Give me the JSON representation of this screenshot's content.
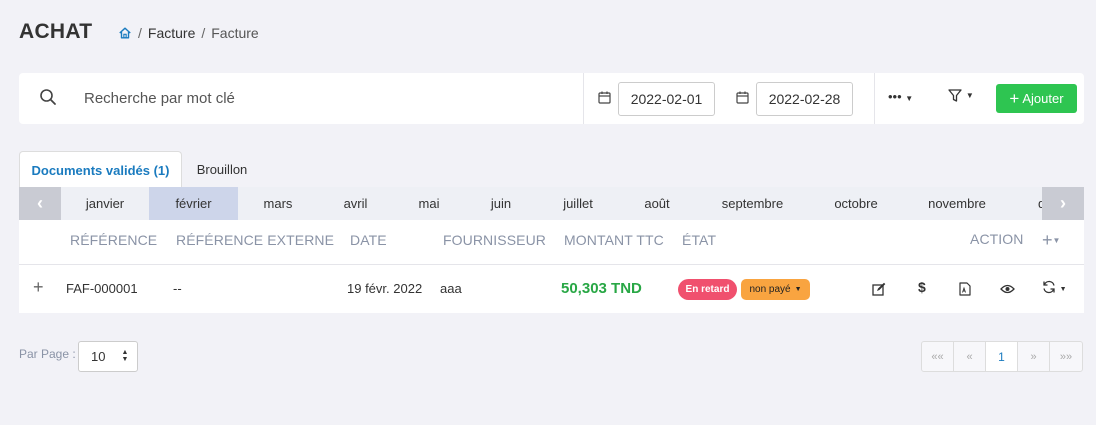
{
  "header": {
    "title": "ACHAT",
    "breadcrumb": [
      "Facture",
      "Facture"
    ],
    "separator": "/"
  },
  "search": {
    "placeholder": "Recherche par mot clé",
    "date_from": "2022-02-01",
    "date_to": "2022-02-28",
    "more_label": "•••",
    "add_label": "Ajouter"
  },
  "tabs": [
    {
      "label": "Documents validés (1)",
      "active": true
    },
    {
      "label": "Brouillon",
      "active": false
    }
  ],
  "months": {
    "items": [
      "janvier",
      "février",
      "mars",
      "avril",
      "mai",
      "juin",
      "juillet",
      "août",
      "septembre",
      "octobre",
      "novembre",
      "d"
    ],
    "selected": "février"
  },
  "table": {
    "columns": {
      "reference": "RÉFÉRENCE",
      "external_reference": "RÉFÉRENCE EXTERNE",
      "date": "DATE",
      "supplier": "FOURNISSEUR",
      "amount": "MONTANT TTC",
      "state": "ÉTAT",
      "action": "ACTION"
    },
    "rows": [
      {
        "reference": "FAF-000001",
        "external_reference": "--",
        "date": "19 févr. 2022",
        "supplier": "aaa",
        "amount": "50,303 TND",
        "status_late": "En retard",
        "status_payment": "non payé"
      }
    ]
  },
  "footer": {
    "per_page_label": "Par Page :",
    "per_page_value": "10",
    "pagination": [
      "««",
      "«",
      "1",
      "»",
      "»»"
    ]
  },
  "colors": {
    "accent_blue": "#1a7bbf",
    "add_green": "#2ec551",
    "amount_green": "#28a745",
    "badge_red": "#f0506e",
    "badge_orange": "#f9a440"
  }
}
